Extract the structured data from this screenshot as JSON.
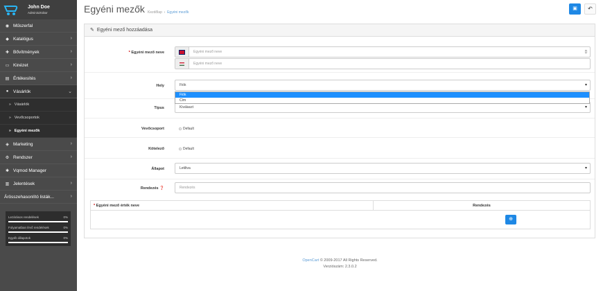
{
  "user": {
    "name": "John Doe",
    "role": "Adminisztrátor"
  },
  "menu": [
    {
      "label": "Műszerfal",
      "icon": "dashboard-icon",
      "glyph": "◉"
    },
    {
      "label": "Katalógus",
      "icon": "tag-icon",
      "glyph": "◆"
    },
    {
      "label": "Bővítmények",
      "icon": "puzzle-icon",
      "glyph": "✚"
    },
    {
      "label": "Kinézet",
      "icon": "monitor-icon",
      "glyph": "▭"
    },
    {
      "label": "Értékesítés",
      "icon": "cart-icon",
      "glyph": "▤"
    },
    {
      "label": "Vásárlók",
      "icon": "user-icon",
      "glyph": "●"
    }
  ],
  "submenu": [
    {
      "label": "Vásárlók"
    },
    {
      "label": "Vevőcsoportok"
    },
    {
      "label": "Egyéni mezők"
    }
  ],
  "menu2": [
    {
      "label": "Marketing",
      "icon": "share-icon",
      "glyph": "◈"
    },
    {
      "label": "Rendszer",
      "icon": "gear-icon",
      "glyph": "⚙"
    },
    {
      "label": "Vqmod Manager",
      "icon": "cog-icon",
      "glyph": "✱"
    },
    {
      "label": "Jelentések",
      "icon": "chart-icon",
      "glyph": "▥"
    },
    {
      "label": "Árösszehasonlító listák...",
      "icon": "",
      "glyph": ""
    }
  ],
  "stats": [
    {
      "label": "Lezárásos rendelések",
      "value": "0%"
    },
    {
      "label": "Folyamatban lévő rendelések",
      "value": "0%"
    },
    {
      "label": "Egyéb állapotok",
      "value": "0%"
    }
  ],
  "page": {
    "title": "Egyéni mezők",
    "breadcrumb_home": "Kezdőlap",
    "breadcrumb_current": "Egyéni mezők"
  },
  "panel": {
    "title": "Egyéni mező hozzáadása"
  },
  "form": {
    "name_label": "Egyéni mező neve",
    "name_placeholder_en": "Egyéni mező neve",
    "name_placeholder_hu": "Egyéni mező neve",
    "location_label": "Hely",
    "location_value": "Fiók",
    "location_options": [
      "Fiók",
      "Cím"
    ],
    "type_label": "Típus",
    "type_value": "Kiválaszt",
    "group_label": "Vevőcsoport",
    "group_option": "Default",
    "required_label": "Kötelező",
    "required_option": "Default",
    "status_label": "Állapot",
    "status_value": "Letiltva",
    "sort_label": "Rendezés",
    "sort_placeholder": "Rendezés"
  },
  "value_table": {
    "col_name": "Egyéni mező érték neve",
    "col_sort": "Rendezés"
  },
  "footer": {
    "brand": "OpenCart",
    "copyright": "© 2009-2017 All Rights Reserved.",
    "version": "Verziószám: 2.3.0.2"
  },
  "colors": {
    "primary": "#1e88e5",
    "sidebar": "#4a4a4a"
  }
}
